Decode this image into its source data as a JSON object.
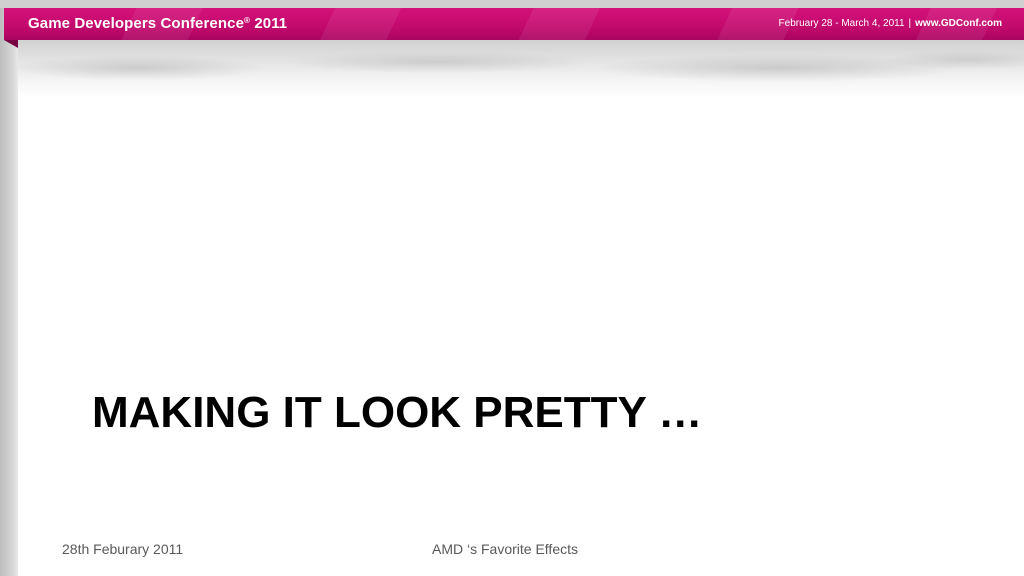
{
  "header": {
    "conference_name": "Game Developers Conference",
    "registered_mark": "®",
    "year": "2011",
    "dates": "February 28 - March 4, 2011",
    "separator": "|",
    "url": "www.GDConf.com"
  },
  "slide": {
    "title": "MAKING IT LOOK PRETTY …"
  },
  "footer": {
    "date": "28th Feburary 2011",
    "center": "AMD ‘s Favorite Effects"
  },
  "colors": {
    "header_magenta": "#c2096c",
    "text": "#000000",
    "footer_text": "#595959"
  }
}
